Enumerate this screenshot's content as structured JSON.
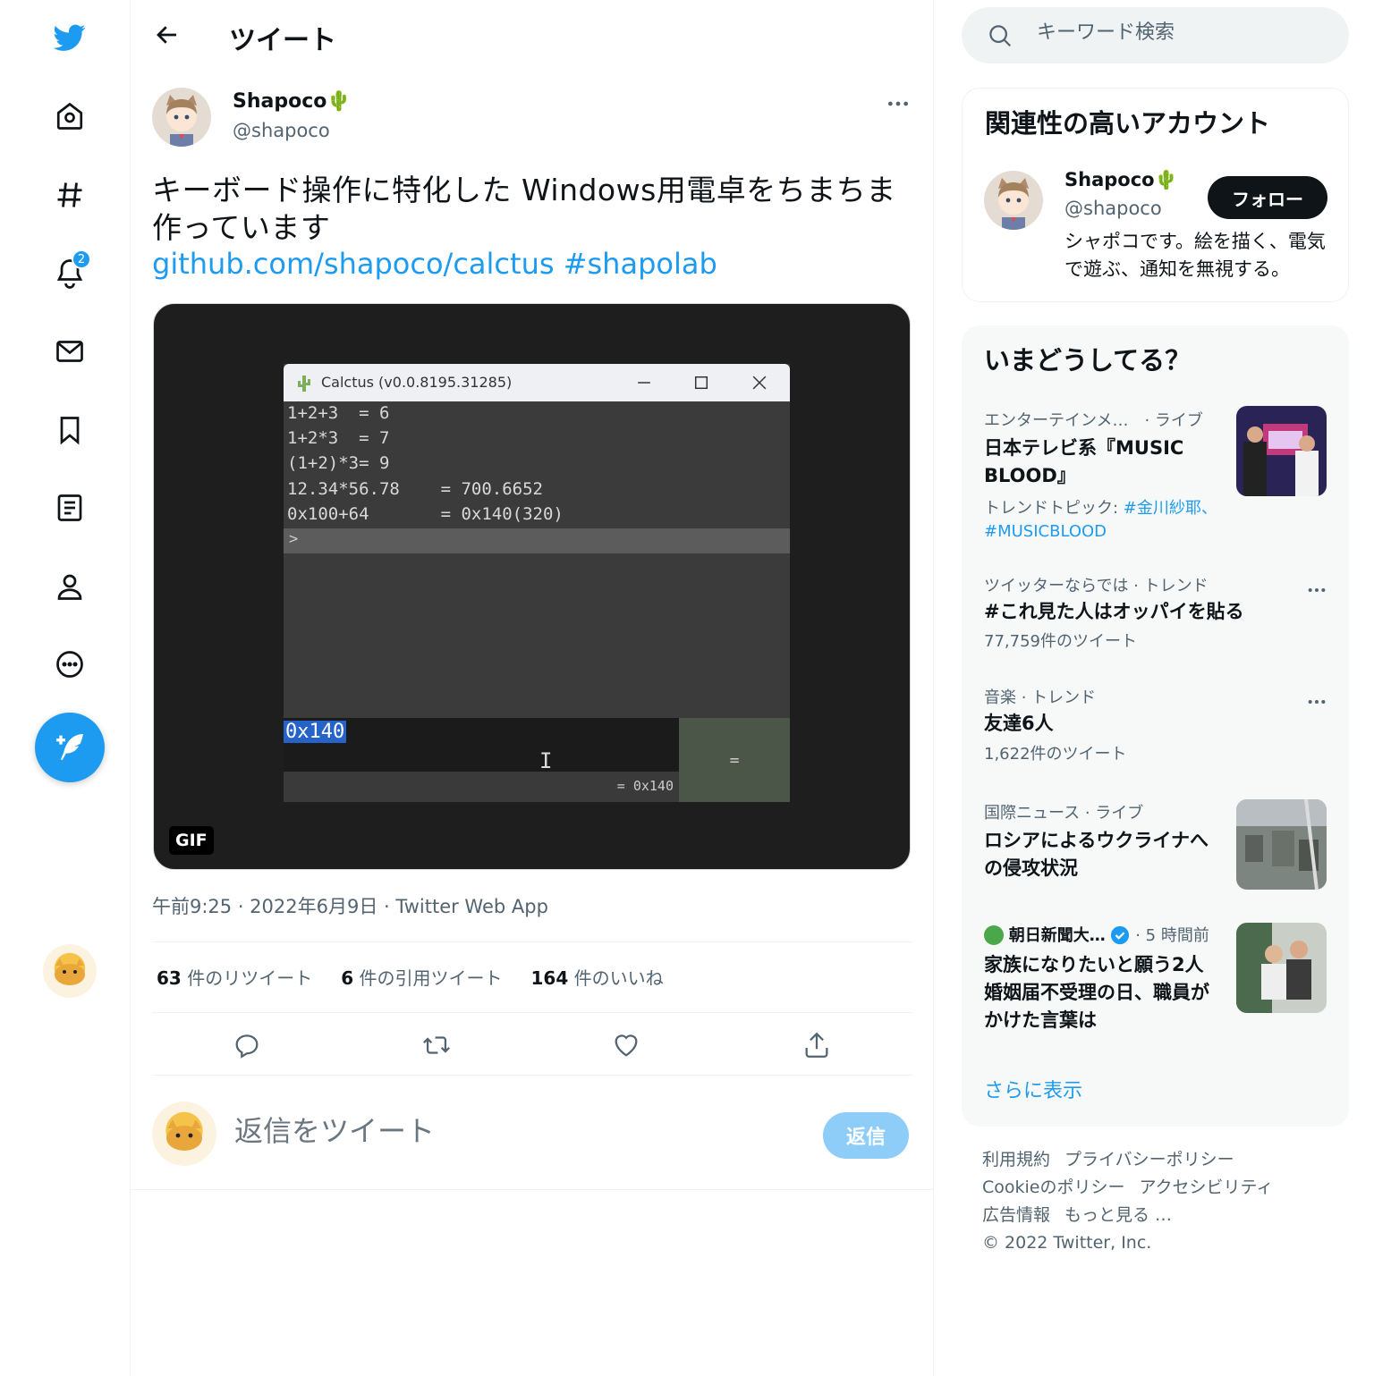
{
  "nav": {
    "notifications_badge": "2"
  },
  "header": {
    "title": "ツイート"
  },
  "tweet": {
    "author_name": "Shapoco🌵",
    "author_handle": "@shapoco",
    "text": "キーボード操作に特化した Windows用電卓をちまちま作っています",
    "link": "github.com/shapoco/calctus",
    "hashtag": "#shapolab",
    "media": {
      "window_title": "Calctus (v0.0.8195.31285)",
      "history": [
        "1+2+3  = 6",
        "1+2*3  = 7",
        "(1+2)*3= 9",
        "12.34*56.78    = 700.6652",
        "0x100+64       = 0x140(320)"
      ],
      "prompt": ">",
      "input_value": "0x140",
      "cursor": "I",
      "equals_label": "=",
      "result": "= 0x140",
      "badge": "GIF"
    },
    "timestamp": "午前9:25 · 2022年6月9日 · Twitter Web App",
    "stats": {
      "retweets_count": "63",
      "retweets_label": "件のリツイート",
      "quotes_count": "6",
      "quotes_label": "件の引用ツイート",
      "likes_count": "164",
      "likes_label": "件のいいね"
    }
  },
  "reply": {
    "placeholder": "返信をツイート",
    "button_label": "返信"
  },
  "search": {
    "placeholder": "キーワード検索"
  },
  "related": {
    "title": "関連性の高いアカウント",
    "name": "Shapoco🌵",
    "handle": "@shapoco",
    "follow_label": "フォロー",
    "bio": "シャポコです。絵を描く、電気で遊ぶ、通知を無視する。"
  },
  "trends": {
    "title": "いまどうしてる？",
    "items": [
      {
        "meta": "エンターテインメ…　· ライブ",
        "title": "日本テレビ系『MUSIC BLOOD』",
        "sub_prefix": "トレンドトピック: ",
        "sub_tags": "#金川紗耶、#MUSICBLOOD"
      },
      {
        "meta": "ツイッターならでは · トレンド",
        "title": "#これ見た人はオッパイを貼る",
        "sub": "77,759件のツイート"
      },
      {
        "meta": "音楽 · トレンド",
        "title": "友達6人",
        "sub": "1,622件のツイート"
      },
      {
        "meta": "国際ニュース · ライブ",
        "title": "ロシアによるウクライナへの侵攻状況"
      },
      {
        "source": "朝日新聞大…",
        "meta": "· 5 時間前",
        "title": "家族になりたいと願う2人 婚姻届不受理の日、職員がかけた言葉は"
      }
    ],
    "show_more": "さらに表示"
  },
  "footer": {
    "terms": "利用規約",
    "privacy": "プライバシーポリシー",
    "cookie": "Cookieのポリシー",
    "accessibility": "アクセシビリティ",
    "ads": "広告情報",
    "more": "もっと見る …",
    "copyright": "© 2022 Twitter, Inc."
  },
  "colors": {
    "accent": "#1d9bf0",
    "text": "#0f1419",
    "secondary": "#536471"
  }
}
